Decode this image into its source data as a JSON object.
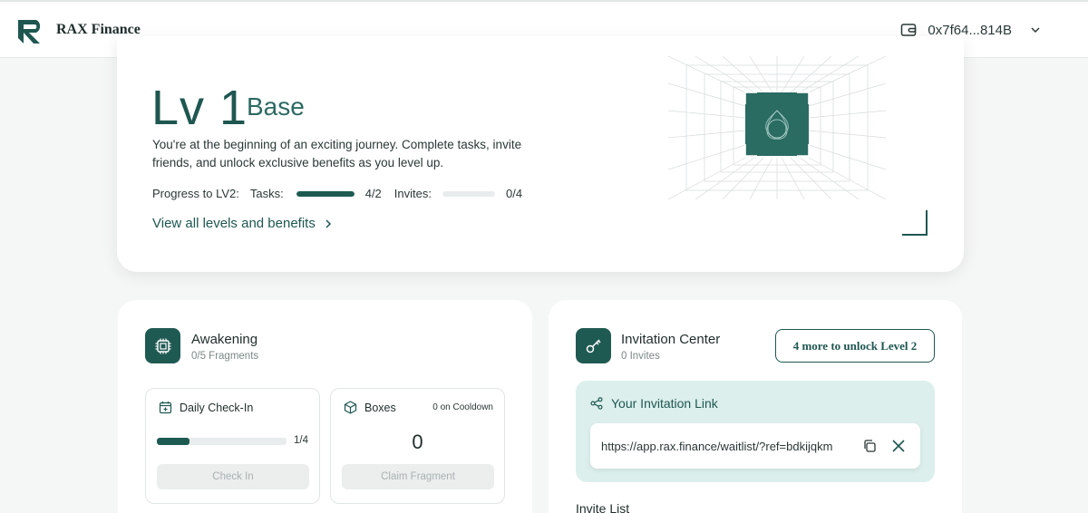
{
  "header": {
    "brand": "RAX Finance",
    "wallet_address": "0x7f64...814B"
  },
  "level": {
    "title": "Lv 1",
    "name": "Base",
    "description": "You're at the beginning of an exciting journey. Complete tasks, invite friends, and unlock exclusive benefits as you level up.",
    "progress_label": "Progress to LV2:",
    "tasks_label": "Tasks:",
    "tasks_value": "4/2",
    "tasks_fill": 1.0,
    "invites_label": "Invites:",
    "invites_value": "0/4",
    "invites_fill": 0.0,
    "view_link": "View all levels and benefits"
  },
  "awakening": {
    "title": "Awakening",
    "subtitle": "0/5 Fragments",
    "daily": {
      "title": "Daily Check-In",
      "progress_text": "1/4",
      "fill": 0.25,
      "button": "Check In"
    },
    "boxes": {
      "title": "Boxes",
      "cooldown": "0 on Cooldown",
      "count": "0",
      "button": "Claim Fragment"
    }
  },
  "invitation": {
    "title": "Invitation Center",
    "subtitle": "0 Invites",
    "unlock_button": "4 more to unlock Level 2",
    "link_heading": "Your Invitation Link",
    "link_url": "https://app.rax.finance/waitlist/?ref=bdkijqkm",
    "invite_list_heading": "Invite List"
  },
  "colors": {
    "accent": "#1e5750",
    "panel": "#dcefed",
    "background": "#f5f6f6"
  }
}
